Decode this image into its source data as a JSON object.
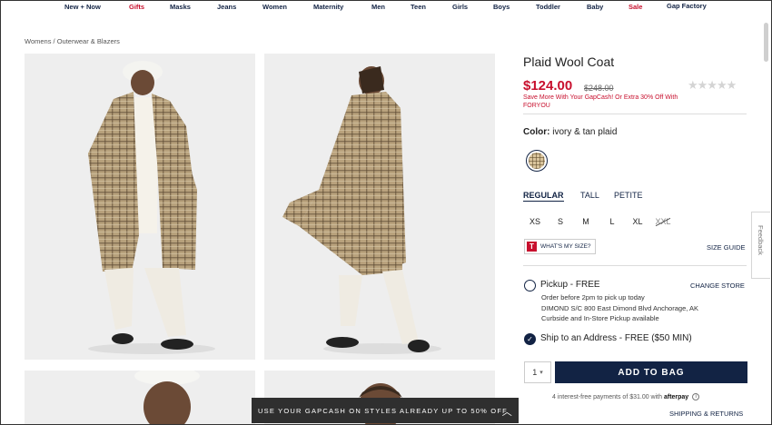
{
  "nav": {
    "items": [
      {
        "label": "New + Now",
        "color": "#122344"
      },
      {
        "label": "Gifts",
        "color": "#c8102e"
      },
      {
        "label": "Masks",
        "color": "#122344"
      },
      {
        "label": "Jeans",
        "color": "#122344"
      },
      {
        "label": "Women",
        "color": "#122344"
      },
      {
        "label": "Maternity",
        "color": "#122344"
      },
      {
        "label": "Men",
        "color": "#122344"
      },
      {
        "label": "Teen",
        "color": "#122344"
      },
      {
        "label": "Girls",
        "color": "#122344"
      },
      {
        "label": "Boys",
        "color": "#122344"
      },
      {
        "label": "Toddler",
        "color": "#122344"
      },
      {
        "label": "Baby",
        "color": "#122344"
      },
      {
        "label": "Sale",
        "color": "#c8102e"
      },
      {
        "label": "Gap Factory",
        "color": "#122344"
      }
    ]
  },
  "breadcrumb": "Womens / Outerwear & Blazers",
  "product": {
    "title": "Plaid Wool Coat",
    "price": "$124.00",
    "original_price": "$248.00",
    "stars": "★★★★★",
    "promo": "Save More With Your GapCash! Or Extra 30% Off With FORYOU",
    "color_label": "Color:",
    "color_value": "ivory & tan plaid"
  },
  "fit": {
    "tabs": [
      "REGULAR",
      "TALL",
      "PETITE"
    ],
    "selected": "REGULAR"
  },
  "sizes": [
    {
      "label": "XS",
      "available": true
    },
    {
      "label": "S",
      "available": true
    },
    {
      "label": "M",
      "available": true
    },
    {
      "label": "L",
      "available": true
    },
    {
      "label": "XL",
      "available": true
    },
    {
      "label": "XXL",
      "available": false
    }
  ],
  "whats_my_size": {
    "icon": "T",
    "label": "WHAT'S MY SIZE?"
  },
  "size_guide": "SIZE GUIDE",
  "pickup": {
    "label": "Pickup - FREE",
    "change_store": "CHANGE STORE",
    "line1": "Order before 2pm to pick up today",
    "line2": "DIMOND S/C 800 East Dimond Blvd  Anchorage, AK",
    "line3": "Curbside and In-Store Pickup available",
    "selected": false
  },
  "ship": {
    "label": "Ship to an Address - FREE ($50 MIN)",
    "selected": true
  },
  "quantity": "1",
  "add_to_bag": "ADD TO BAG",
  "afterpay": {
    "text": "4 interest-free payments of $31.00 with",
    "brand": "afterpay",
    "info": "i"
  },
  "shipping_returns": "SHIPPING & RETURNS",
  "banner": {
    "text": "USE YOUR GAPCASH ON STYLES ALREADY UP TO 50% OFF",
    "icon": "chevron-up-icon"
  },
  "feedback": "Feedback",
  "colors": {
    "brand_navy": "#122344",
    "sale_red": "#c8102e"
  }
}
